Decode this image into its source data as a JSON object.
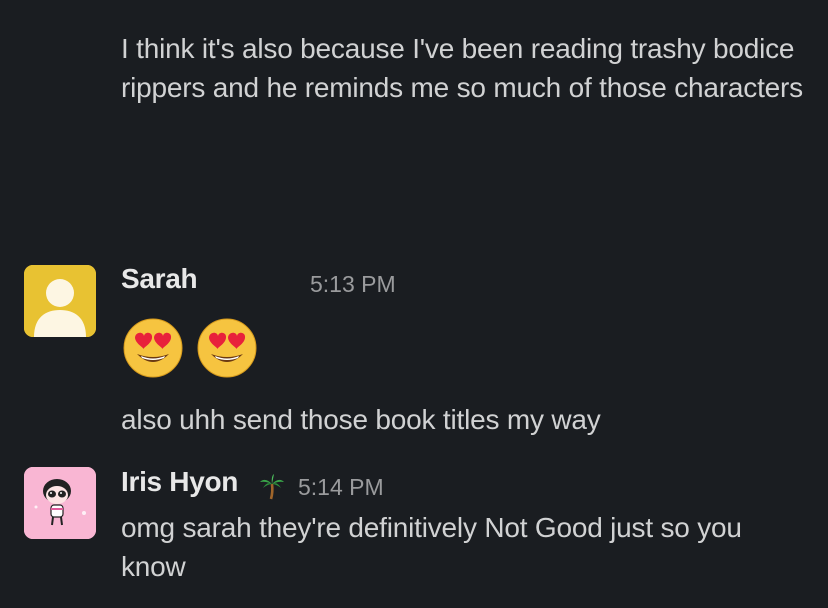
{
  "messages": {
    "continuation": {
      "text": "I think it's also because I've been reading trashy bodice rippers and he reminds me so much of those characters"
    },
    "sarah": {
      "author": "Sarah",
      "time": "5:13 PM",
      "reactions": [
        "heart-eyes-emoji",
        "heart-eyes-emoji"
      ],
      "text": "also uhh send those book titles my way"
    },
    "iris": {
      "author": "Iris Hyon",
      "status_icon": "palm-tree-icon",
      "time": "5:14 PM",
      "text": "omg sarah they're definitively Not Good just so you know"
    }
  },
  "colors": {
    "background": "#1a1d21",
    "text": "#d1d2d3",
    "timestamp": "#9a9b9d",
    "sarah_avatar": "#e8c232",
    "iris_avatar": "#f9b6d3"
  }
}
